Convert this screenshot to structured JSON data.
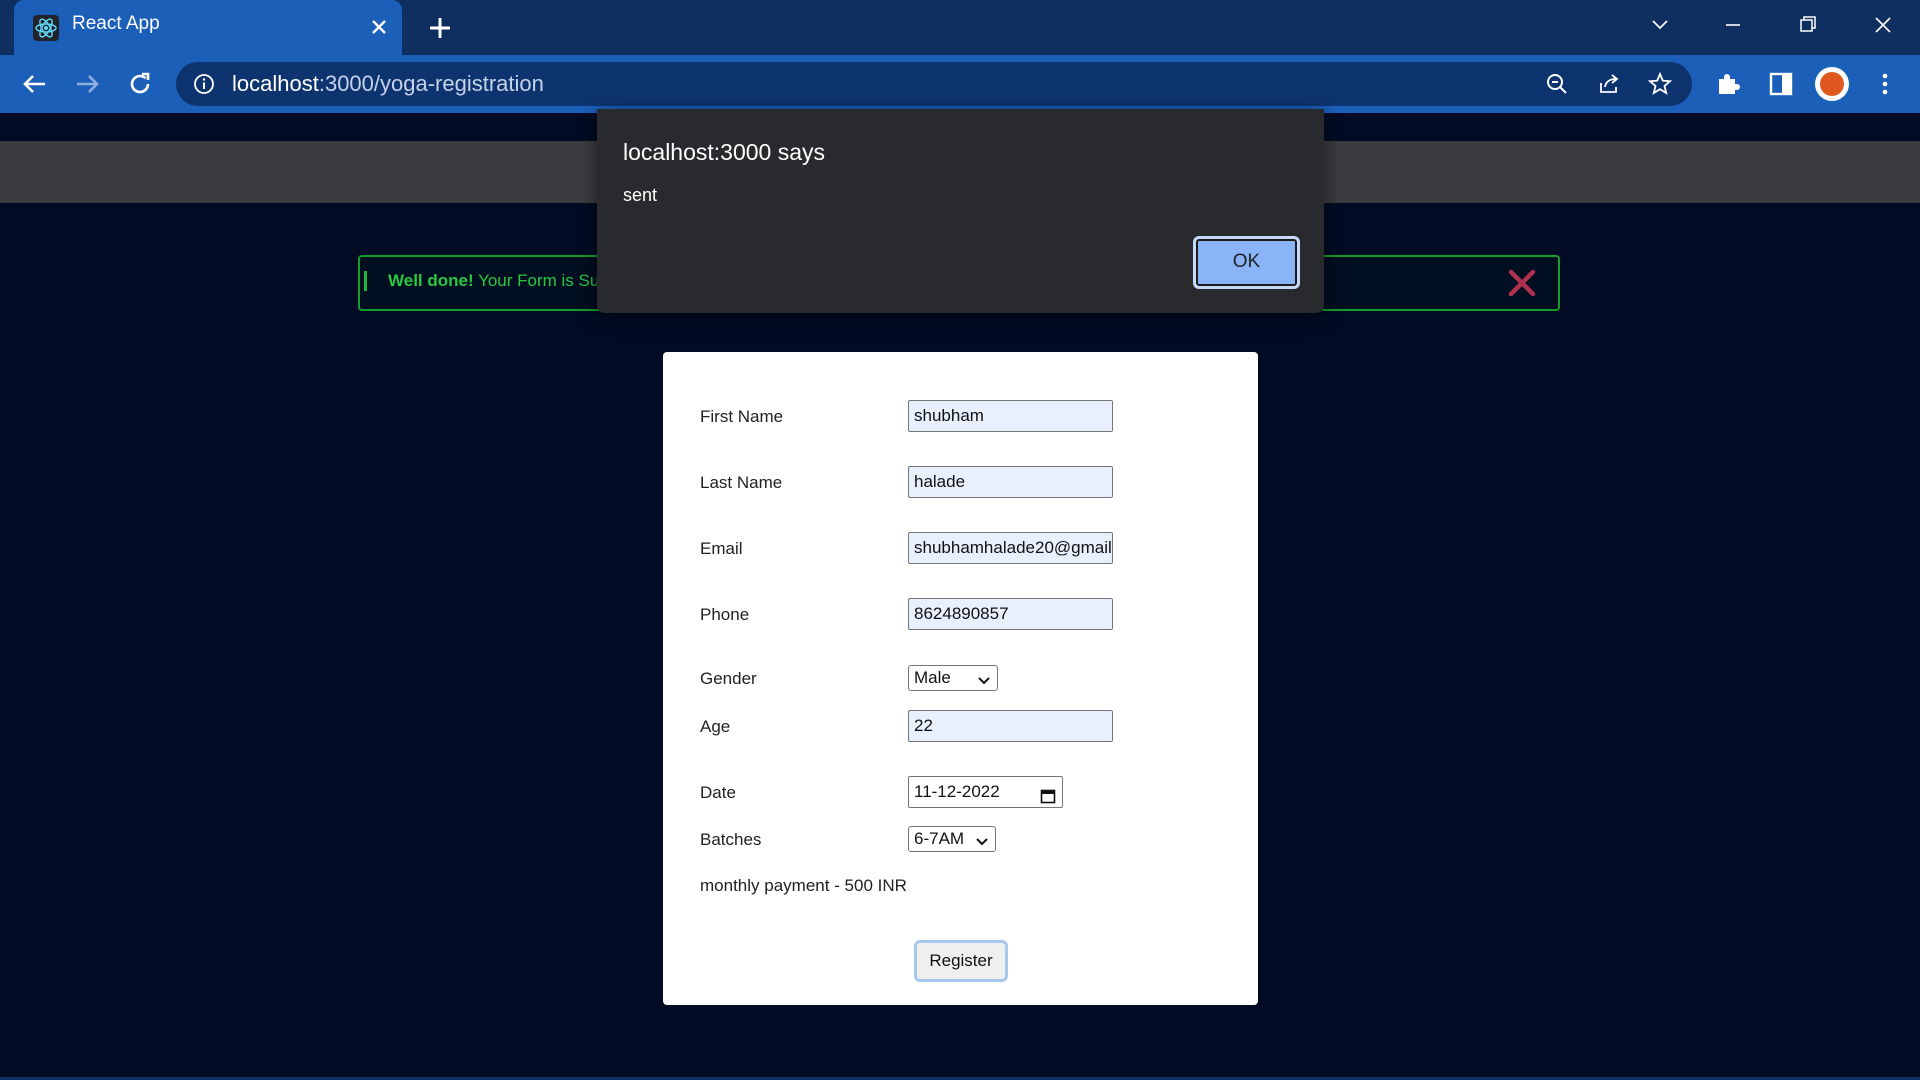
{
  "browser": {
    "tab_title": "React App",
    "url_host": "localhost",
    "url_path": ":3000/yoga-registration"
  },
  "alert_banner": {
    "bold_text": "Well done!",
    "text": "Your Form is Su",
    "border_color": "#149e2c"
  },
  "form": {
    "first_name": {
      "label": "First Name",
      "value": "shubham"
    },
    "last_name": {
      "label": "Last Name",
      "value": "halade"
    },
    "email": {
      "label": "Email",
      "value": "shubhamhalade20@gmail"
    },
    "phone": {
      "label": "Phone",
      "value": "8624890857"
    },
    "gender": {
      "label": "Gender",
      "selected": "Male"
    },
    "age": {
      "label": "Age",
      "value": "22"
    },
    "date": {
      "label": "Date",
      "value": "11-12-2022"
    },
    "batches": {
      "label": "Batches",
      "selected": "6-7AM"
    },
    "payment_note": "monthly payment - 500 INR",
    "register_label": "Register"
  },
  "dialog": {
    "title": "localhost:3000 says",
    "message": "sent",
    "ok_label": "OK",
    "ok_color": "#8ab4f8"
  },
  "colors": {
    "page_bg": "#010c24",
    "chrome_tabstrip": "#0f2f60",
    "chrome_toolbar": "#1b5fb9"
  }
}
